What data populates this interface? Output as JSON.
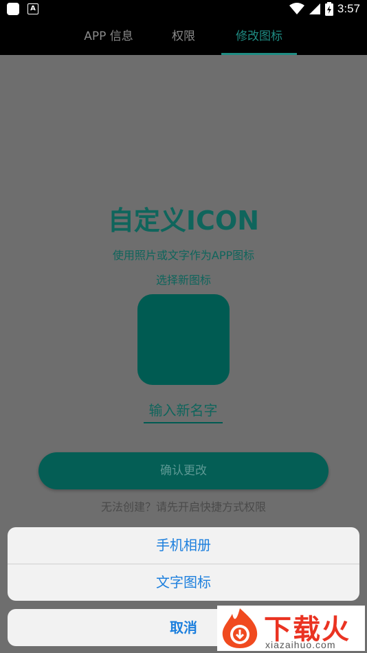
{
  "status_bar": {
    "time": "3:57",
    "icons": [
      "app-icon",
      "a-icon",
      "wifi-icon",
      "signal-icon",
      "battery-icon"
    ]
  },
  "tabs": [
    {
      "label": "APP 信息",
      "active": false
    },
    {
      "label": "权限",
      "active": false
    },
    {
      "label": "修改图标",
      "active": true
    }
  ],
  "main": {
    "title": "自定义ICON",
    "subtitle": "使用照片或文字作为APP图标",
    "choose_icon_label": "选择新图标",
    "name_placeholder": "输入新名字",
    "confirm_label": "确认更改",
    "hint": "无法创建？请先开启快捷方式权限"
  },
  "action_sheet": {
    "options": [
      "手机相册",
      "文字图标"
    ],
    "cancel_label": "取消"
  },
  "watermark": {
    "brand": "下载火",
    "site": "xiazaihuo.com"
  },
  "colors": {
    "accent": "#1f8c83",
    "icon_fill": "#005b52",
    "sheet_text": "#1c7fdd",
    "overlay": "#6e6e6e"
  }
}
